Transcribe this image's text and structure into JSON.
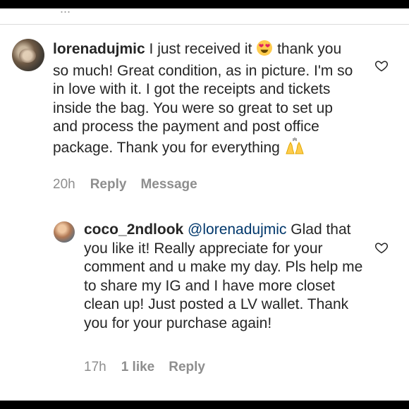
{
  "top_partial_text": "...",
  "comments": [
    {
      "username": "lorenadujmic",
      "text_part1": " I just received it ",
      "emoji_1": "heart-eyes-emoji",
      "text_part2": " thank you so much! Great condition, as in picture. I'm so in love with it. I got the receipts and tickets inside the bag. You were so great to set up and process the payment and post office package. Thank you for everything ",
      "emoji_2": "raising-hands-emoji",
      "time": "20h",
      "actions": [
        "Reply",
        "Message"
      ]
    },
    {
      "username": "coco_2ndlook",
      "mention": "@lorenadujmic",
      "text": " Glad that you like it!  Really appreciate for your comment and u make my day. Pls help me to share my IG and I have more closet clean up!  Just posted a LV wallet.  Thank you for your purchase again!",
      "time": "17h",
      "likes": "1 like",
      "actions": [
        "Reply"
      ]
    }
  ],
  "colors": {
    "text": "#262626",
    "meta": "#8e8e8e",
    "mention": "#00376b",
    "frame": "#000000"
  }
}
